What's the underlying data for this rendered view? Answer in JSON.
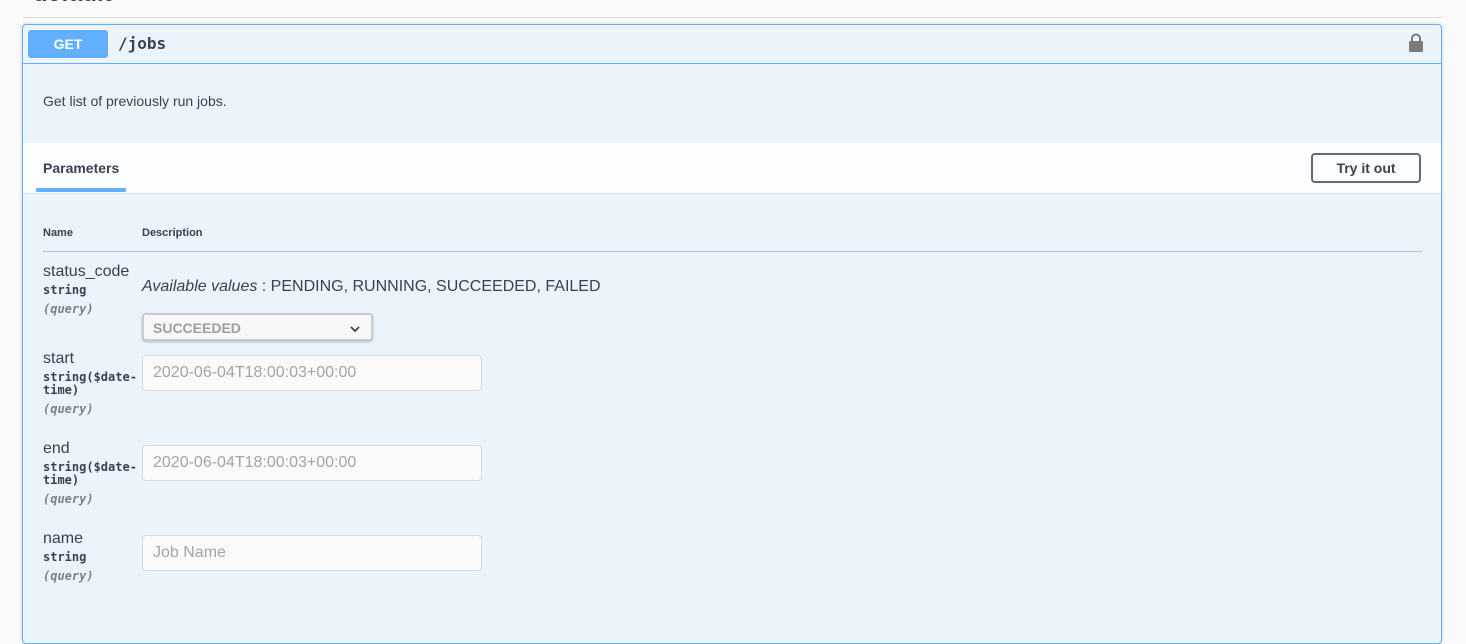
{
  "section": {
    "title": "default"
  },
  "operation": {
    "method": "GET",
    "path": "/jobs",
    "description": "Get list of previously run jobs."
  },
  "params_section": {
    "tab_label": "Parameters",
    "try_button": "Try it out",
    "col_name": "Name",
    "col_description": "Description"
  },
  "params": [
    {
      "name": "status_code",
      "type": "string",
      "in": "(query)",
      "available_label": "Available values",
      "available_values": " : PENDING, RUNNING, SUCCEEDED, FAILED",
      "selected": "SUCCEEDED"
    },
    {
      "name": "start",
      "type_line1": "string($date-",
      "type_line2": "time)",
      "in": "(query)",
      "placeholder": "2020-06-04T18:00:03+00:00"
    },
    {
      "name": "end",
      "type_line1": "string($date-",
      "type_line2": "time)",
      "in": "(query)",
      "placeholder": "2020-06-04T18:00:03+00:00"
    },
    {
      "name": "name",
      "type": "string",
      "in": "(query)",
      "placeholder": "Job Name"
    }
  ],
  "icons": {
    "lock": "lock-icon",
    "chevron": "chevron-down-icon"
  },
  "colors": {
    "accent": "#61affe",
    "background": "#ebf3fb"
  }
}
